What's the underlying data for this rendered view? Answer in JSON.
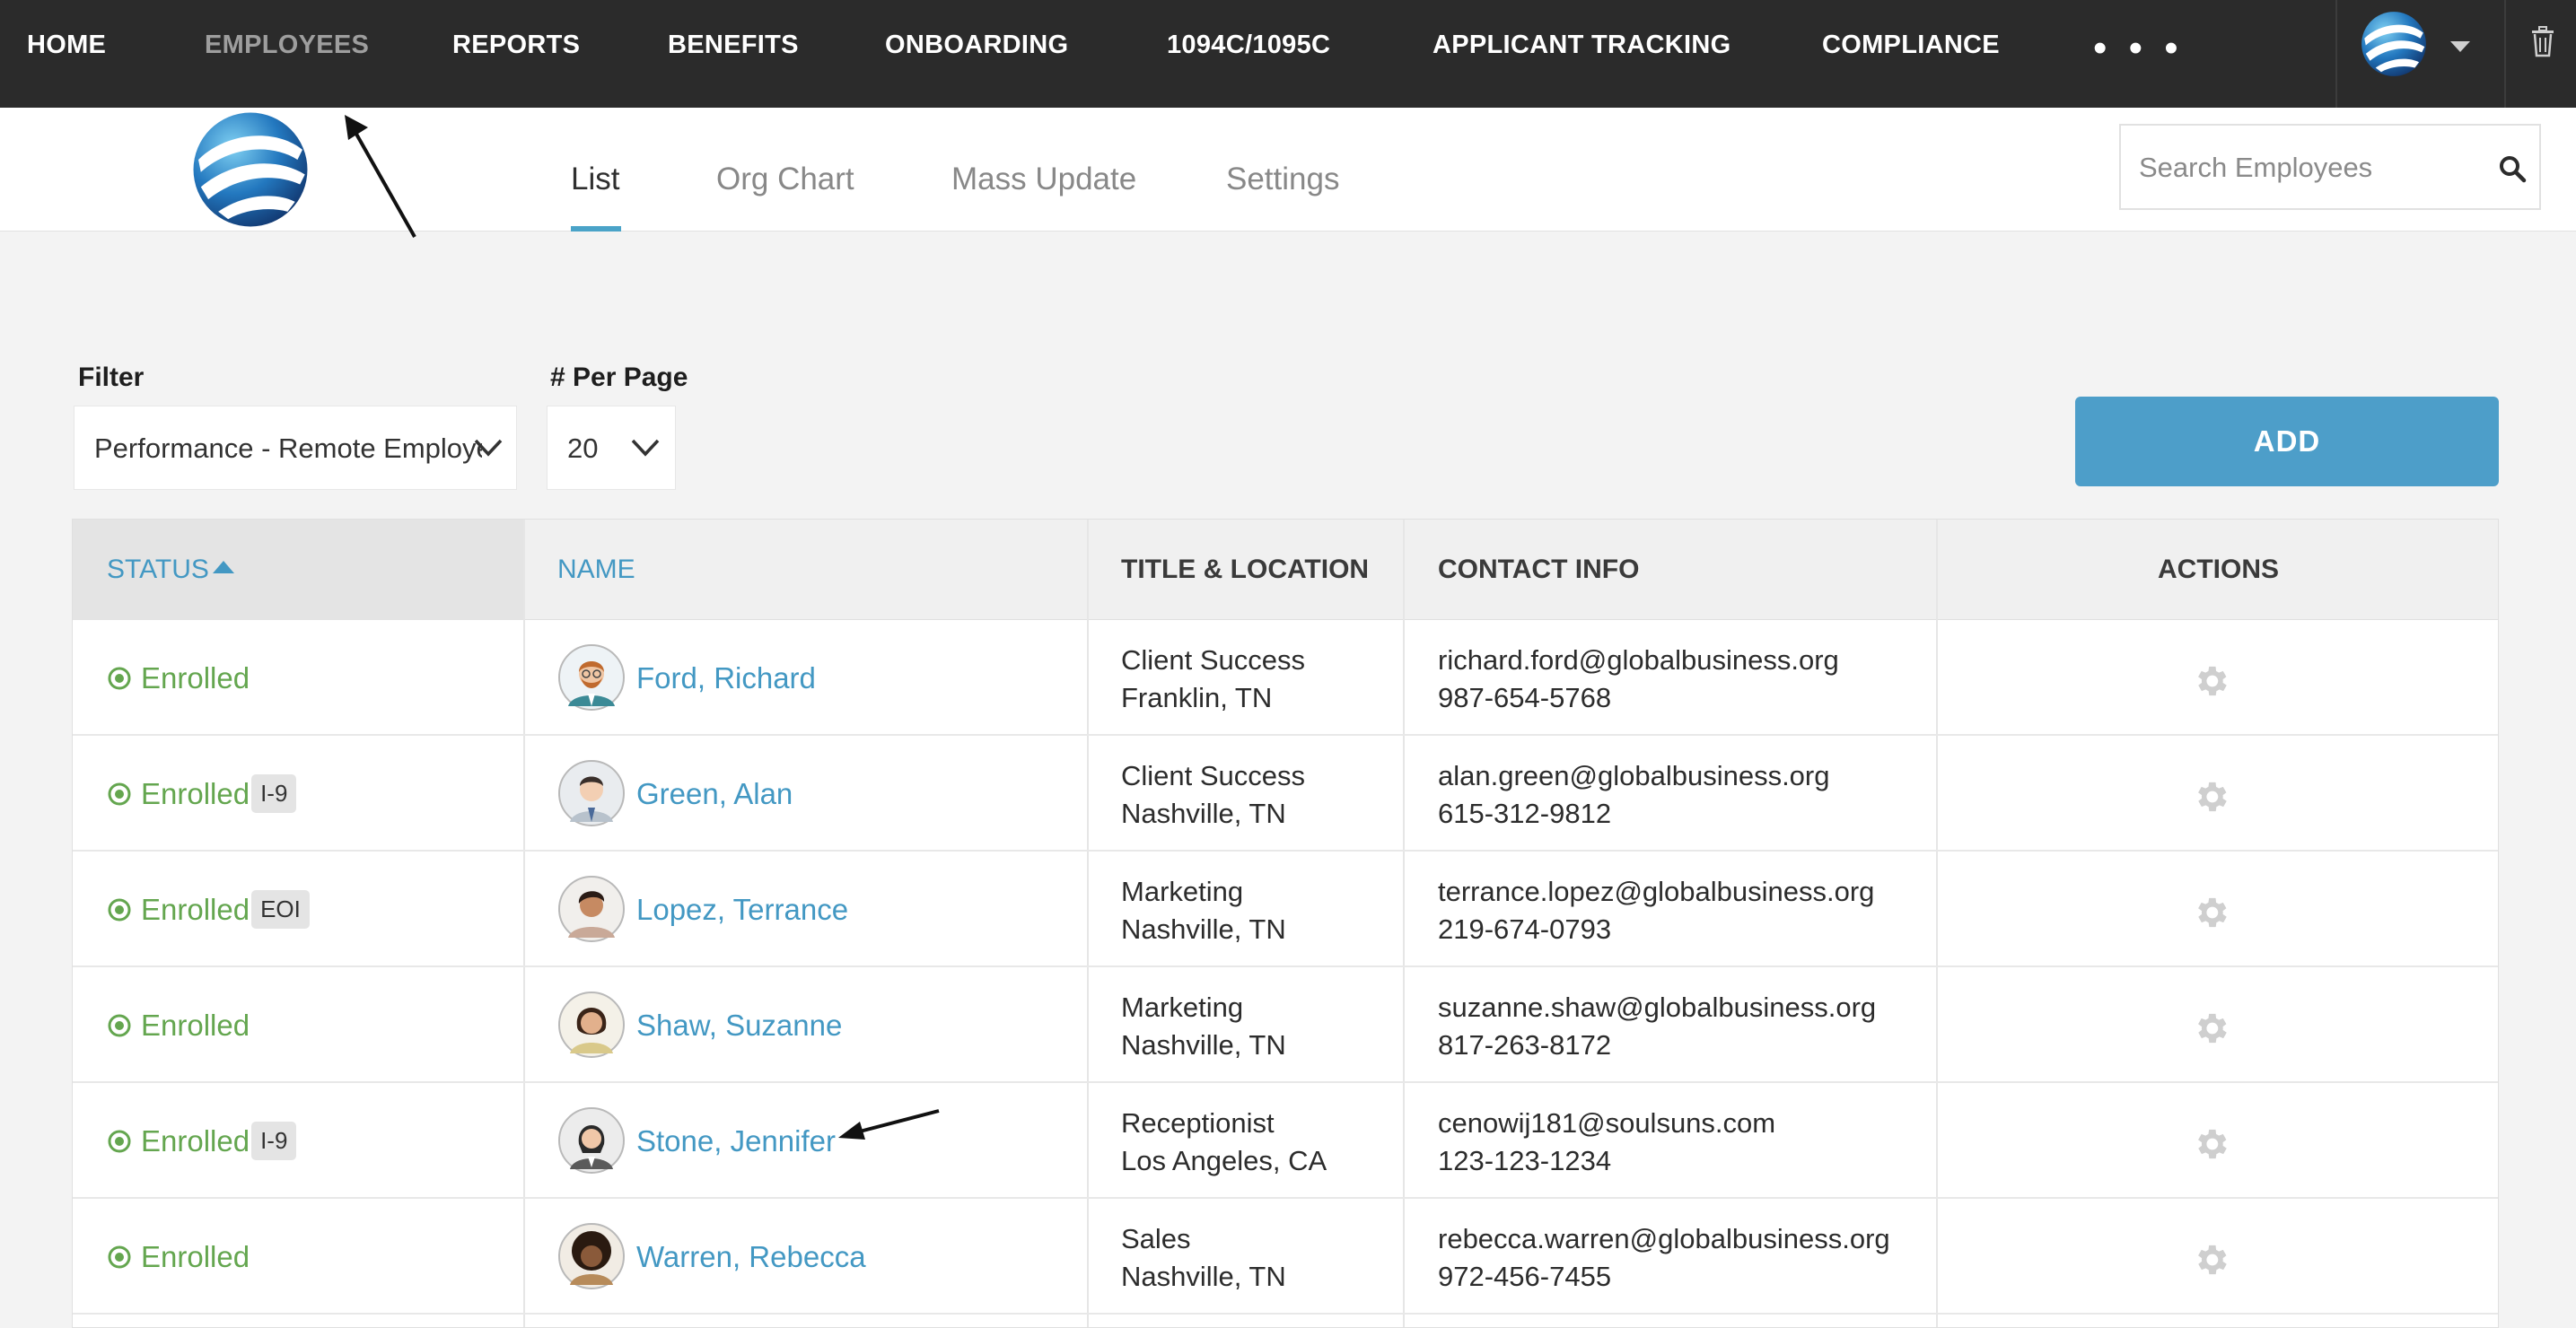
{
  "nav": {
    "items": [
      "HOME",
      "EMPLOYEES",
      "REPORTS",
      "BENEFITS",
      "ONBOARDING",
      "1094C/1095C",
      "APPLICANT TRACKING",
      "COMPLIANCE"
    ],
    "active": "EMPLOYEES",
    "more": "• • •"
  },
  "tabs": [
    "List",
    "Org Chart",
    "Mass Update",
    "Settings"
  ],
  "active_tab": "List",
  "search": {
    "placeholder": "Search Employees"
  },
  "filter": {
    "label": "Filter",
    "value": "Performance - Remote Employees"
  },
  "per_page": {
    "label": "# Per Page",
    "value": "20"
  },
  "add_label": "ADD",
  "table": {
    "headers": {
      "status": "STATUS",
      "name": "NAME",
      "title_location": "TITLE & LOCATION",
      "contact": "CONTACT INFO",
      "actions": "ACTIONS"
    },
    "rows": [
      {
        "status": "Enrolled",
        "badge": "",
        "name": "Ford, Richard",
        "title": "Client Success",
        "location": "Franklin, TN",
        "email": "richard.ford@globalbusiness.org",
        "phone": "987-654-5768"
      },
      {
        "status": "Enrolled",
        "badge": "I-9",
        "name": "Green, Alan",
        "title": "Client Success",
        "location": "Nashville, TN",
        "email": "alan.green@globalbusiness.org",
        "phone": "615-312-9812"
      },
      {
        "status": "Enrolled",
        "badge": "EOI",
        "name": "Lopez, Terrance",
        "title": "Marketing",
        "location": "Nashville, TN",
        "email": "terrance.lopez@globalbusiness.org",
        "phone": "219-674-0793"
      },
      {
        "status": "Enrolled",
        "badge": "",
        "name": "Shaw, Suzanne",
        "title": "Marketing",
        "location": "Nashville, TN",
        "email": "suzanne.shaw@globalbusiness.org",
        "phone": "817-263-8172"
      },
      {
        "status": "Enrolled",
        "badge": "I-9",
        "name": "Stone, Jennifer",
        "title": "Receptionist",
        "location": "Los Angeles, CA",
        "email": "cenowij181@soulsuns.com",
        "phone": "123-123-1234"
      },
      {
        "status": "Enrolled",
        "badge": "",
        "name": "Warren, Rebecca",
        "title": "Sales",
        "location": "Nashville, TN",
        "email": "rebecca.warren@globalbusiness.org",
        "phone": "972-456-7455"
      }
    ]
  },
  "colors": {
    "accent": "#4398c3",
    "nav_bg": "#2b2b2b",
    "enrolled": "#64a64f",
    "add_button": "#4d9ec9"
  },
  "icons": {
    "logo": "globe-logo",
    "search": "search-icon",
    "settings": "gear-icon",
    "trash": "trash-icon",
    "status": "target-icon",
    "dropdown": "chevron-down-icon"
  }
}
